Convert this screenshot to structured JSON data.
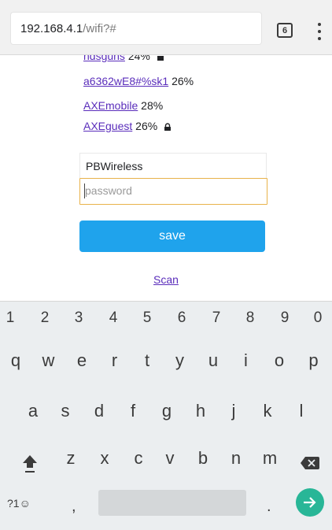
{
  "browser": {
    "url_host": "192.168.4.1",
    "url_path": "/wifi?#",
    "tab_count": "6"
  },
  "networks": [
    {
      "name": "ndsguns",
      "signal": "24%",
      "icon": "lock-icon"
    },
    {
      "name": "a6362wE8#%sk1",
      "signal": "26%",
      "icon": ""
    },
    {
      "name": "AXEmobile",
      "signal": "28%",
      "icon": ""
    },
    {
      "name": "AXEguest",
      "signal": "26%",
      "icon": "lock-icon"
    }
  ],
  "form": {
    "ssid_value": "PBWireless",
    "password_placeholder": "password",
    "save_label": "save",
    "scan_label": "Scan"
  },
  "keyboard": {
    "numbers": [
      "1",
      "2",
      "3",
      "4",
      "5",
      "6",
      "7",
      "8",
      "9",
      "0"
    ],
    "row1": [
      "q",
      "w",
      "e",
      "r",
      "t",
      "y",
      "u",
      "i",
      "o",
      "p"
    ],
    "row2": [
      "a",
      "s",
      "d",
      "f",
      "g",
      "h",
      "j",
      "k",
      "l"
    ],
    "row3": [
      "z",
      "x",
      "c",
      "v",
      "b",
      "n",
      "m"
    ],
    "symbols_label": "?1☺",
    "comma": ",",
    "period": ".",
    "accent_color": "#28b697"
  },
  "colors": {
    "button": "#1fa3ec",
    "link": "#5a2dbb",
    "input_focus": "#e8b24a"
  }
}
